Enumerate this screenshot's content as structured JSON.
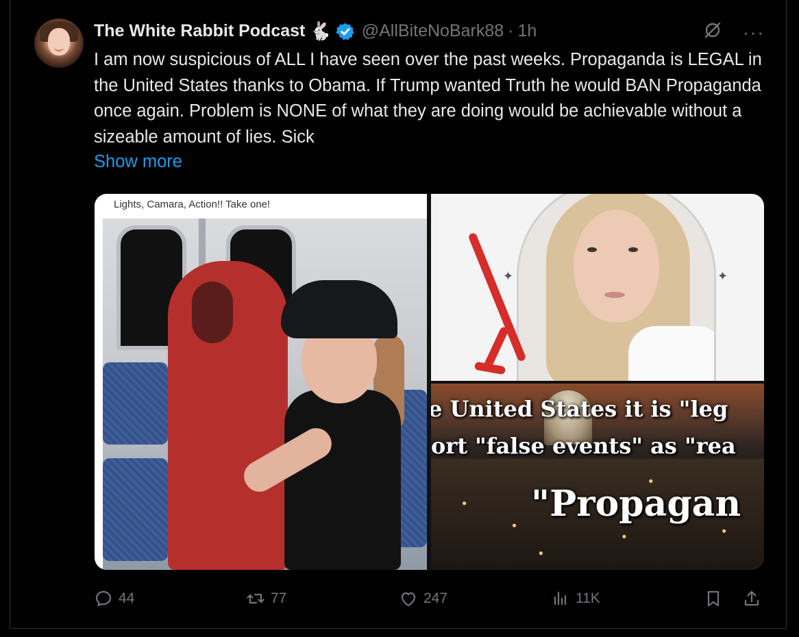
{
  "tweet": {
    "author_name": "The White Rabbit Podcast",
    "author_emoji": "🐇",
    "handle": "@AllBiteNoBark88",
    "separator": "·",
    "time": "1h",
    "text": "I am now suspicious of ALL I have seen over the past weeks. Propaganda is LEGAL in the United States thanks to Obama. If Trump wanted Truth he would BAN Propaganda once again. Problem is NONE of what they are doing would be achievable without a sizeable amount of lies. Sick",
    "show_more": "Show more",
    "more_menu": "···"
  },
  "media": {
    "left_caption": "Lights, Camara, Action!! Take one!",
    "overlay_line1": "e United States it is \"leg",
    "overlay_line2": "ort \"false events\" as \"rea",
    "overlay_line3": "\"Propagan"
  },
  "actions": {
    "replies": "44",
    "reposts": "77",
    "likes": "247",
    "views": "11K"
  },
  "colors": {
    "background": "#000000",
    "text": "#e7e9ea",
    "muted": "#71767b",
    "link": "#1d9bf0",
    "verified": "#1d9bf0",
    "arrow": "#d62d2a"
  }
}
